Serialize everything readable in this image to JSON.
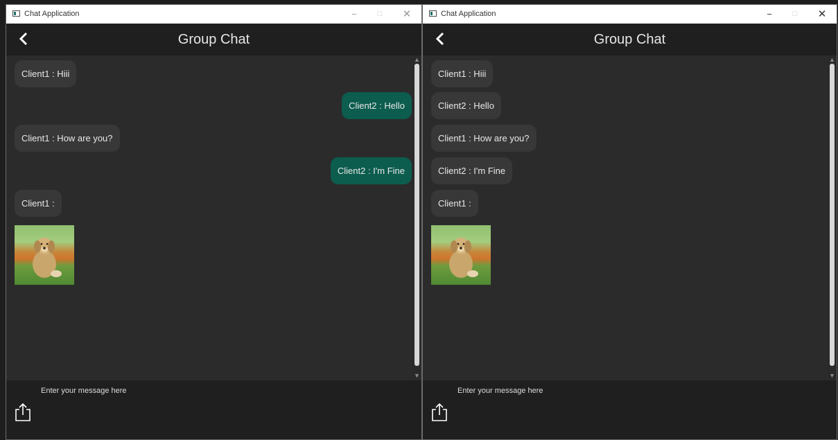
{
  "windows": [
    {
      "title": "Chat Application",
      "header_title": "Group Chat",
      "messages": [
        {
          "text": "Client1 : Hiii",
          "side": "received"
        },
        {
          "text": "Client2 : Hello",
          "side": "sent"
        },
        {
          "text": "Client1 : How are you?",
          "side": "received"
        },
        {
          "text": "Client2 : I'm Fine",
          "side": "sent"
        },
        {
          "text": "Client1 :",
          "side": "received"
        }
      ],
      "image_attachment": "puppy photo",
      "input_placeholder": "Enter your message here"
    },
    {
      "title": "Chat Application",
      "header_title": "Group Chat",
      "messages": [
        {
          "text": "Client1 : Hiii",
          "side": "received"
        },
        {
          "text": "Client2 : Hello",
          "side": "received"
        },
        {
          "text": "Client1 : How are you?",
          "side": "received"
        },
        {
          "text": "Client2 : I'm Fine",
          "side": "received"
        },
        {
          "text": "Client1 :",
          "side": "received"
        }
      ],
      "image_attachment": "puppy photo",
      "input_placeholder": "Enter your message here"
    }
  ],
  "icons": {
    "back": "chevron-left-icon",
    "share": "share-upload-icon",
    "minimize": "−",
    "maximize": "□",
    "close": "✕"
  },
  "colors": {
    "sent_bubble": "#0c5d4e",
    "received_bubble": "#383838",
    "chat_background": "#2b2b2b",
    "header_background": "#1f1f1f"
  }
}
